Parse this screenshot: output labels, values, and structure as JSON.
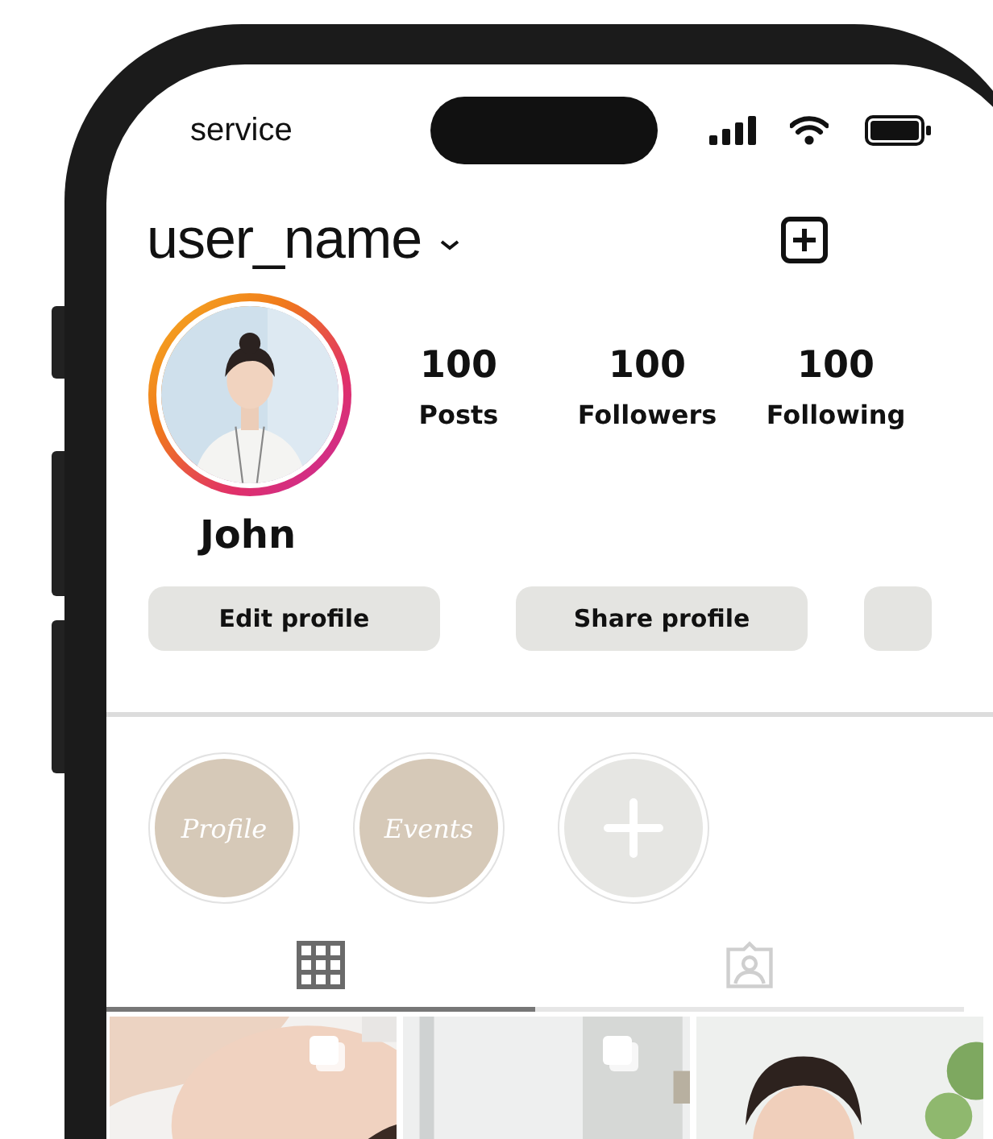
{
  "status_bar": {
    "carrier": "service"
  },
  "header": {
    "username": "user_name"
  },
  "profile": {
    "name": "John",
    "stats": [
      {
        "value": "100",
        "label": "Posts"
      },
      {
        "value": "100",
        "label": "Followers"
      },
      {
        "value": "100",
        "label": "Following"
      }
    ]
  },
  "actions": [
    {
      "kind": "text",
      "label": "Edit profile"
    },
    {
      "kind": "text",
      "label": "Share profile"
    },
    {
      "kind": "blank"
    }
  ],
  "highlights": [
    {
      "kind": "story",
      "label": "Profile"
    },
    {
      "kind": "story",
      "label": "Events"
    },
    {
      "kind": "new"
    }
  ],
  "tabs": [
    {
      "kind": "grid",
      "selected": true
    },
    {
      "kind": "tagged",
      "selected": false
    }
  ],
  "posts": [
    {
      "kind": "picture",
      "multiple": true
    },
    {
      "kind": "picture",
      "multiple": true
    },
    {
      "kind": "picture",
      "multiple": false
    }
  ]
}
